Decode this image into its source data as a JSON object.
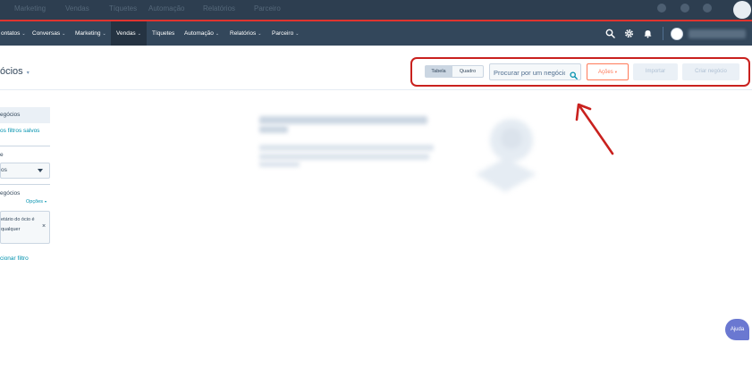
{
  "ghost_bar": {
    "items": [
      "Marketing",
      "Vendas",
      "Tíquetes",
      "Automação",
      "Relatórios",
      "Parceiro"
    ]
  },
  "nav": {
    "items": [
      {
        "label": "ontatos",
        "caret": true
      },
      {
        "label": "Conversas",
        "caret": true
      },
      {
        "label": "Marketing",
        "caret": true
      },
      {
        "label": "Vendas",
        "caret": true,
        "active": true
      },
      {
        "label": "Tíquetes",
        "caret": false
      },
      {
        "label": "Automação",
        "caret": true
      },
      {
        "label": "Relatórios",
        "caret": true
      },
      {
        "label": "Parceiro",
        "caret": true
      }
    ],
    "caret_glyph": "⌄",
    "icons": [
      "search-icon",
      "gear-icon",
      "bell-icon"
    ]
  },
  "header": {
    "title": "ócios",
    "title_caret": "▾"
  },
  "toolbar": {
    "view_table": "Tabela",
    "view_board": "Quadro",
    "search_placeholder": "Procurar por um negócio",
    "actions_label": "Ações",
    "actions_caret": "▾",
    "import_label": "Importar",
    "create_label": "Criar negócio"
  },
  "sidebar": {
    "active_view": "egócios",
    "saved_filters_link": "os filtros salvos",
    "group_label": "e",
    "select_value": "os",
    "section_label": "egócios",
    "options_label": "Opções",
    "options_caret": "▾",
    "filter_text": "etário do ócio é qualquer",
    "close_glyph": "×",
    "add_filter_link": "cionar filtro"
  },
  "help": {
    "label": "Ajuda"
  },
  "colors": {
    "nav_bg": "#33475b",
    "accent_orange": "#ff7a59",
    "link": "#0091ae",
    "annotation_red": "#c9211e",
    "help_bg": "#6a78d1"
  }
}
